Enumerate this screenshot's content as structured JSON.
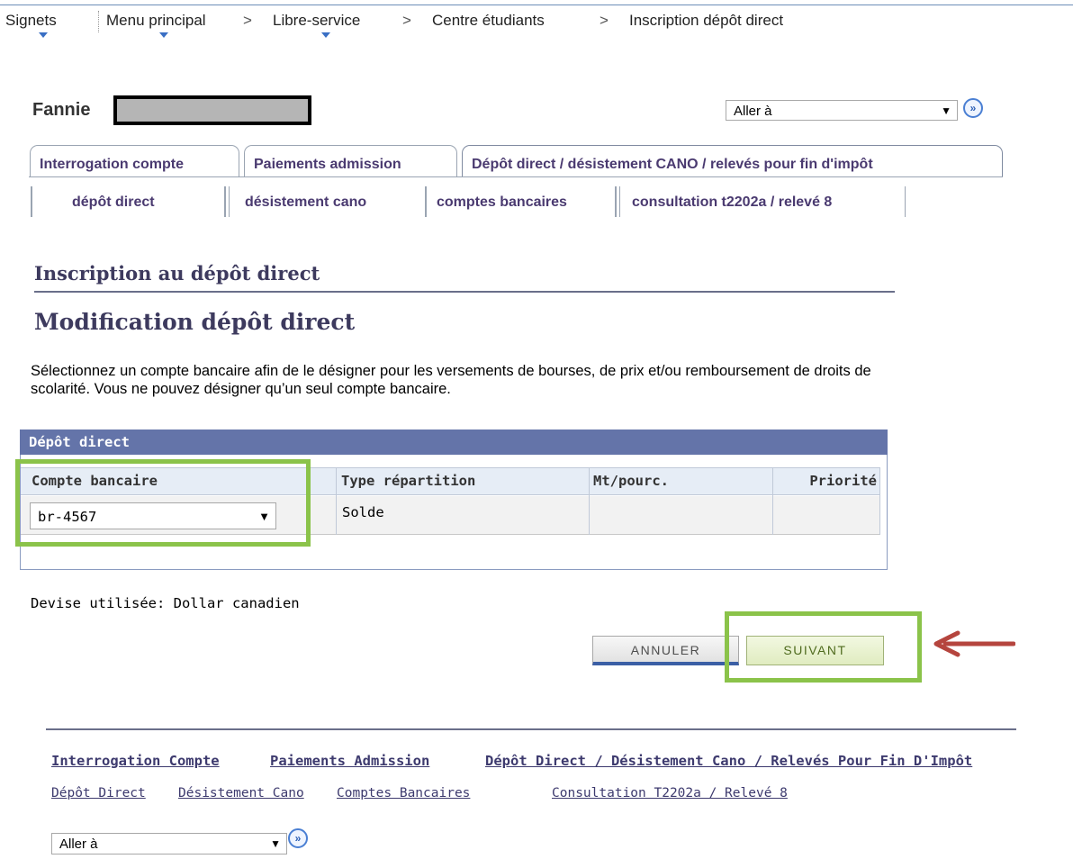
{
  "breadcrumb": {
    "bookmarks": "Signets",
    "main_menu": "Menu principal",
    "self_service": "Libre-service",
    "student_center": "Centre étudiants",
    "current": "Inscription dépôt direct",
    "separator": ">"
  },
  "header": {
    "first_name": "Fannie",
    "goto_value": "Aller à",
    "goto_button": "»"
  },
  "tabs": [
    {
      "label": "Interrogation compte"
    },
    {
      "label": "Paiements admission"
    },
    {
      "label": "Dépôt direct / désistement CANO / relevés pour fin d'impôt"
    }
  ],
  "subtabs": [
    {
      "label": "dépôt direct"
    },
    {
      "label": "désistement cano"
    },
    {
      "label": "comptes bancaires"
    },
    {
      "label": "consultation t2202a / relevé 8"
    }
  ],
  "page": {
    "title": "Inscription au dépôt direct",
    "subtitle": "Modification dépôt direct",
    "instructions": "Sélectionnez un compte bancaire afin de le désigner pour les versements de bourses, de prix et/ou remboursement de droits de scolarité. Vous ne pouvez désigner qu’un seul compte bancaire."
  },
  "grid": {
    "title": "Dépôt direct",
    "columns": [
      "Compte bancaire",
      "Type répartition",
      "Mt/pourc.",
      "Priorité"
    ],
    "rows": [
      {
        "account": "br-4567",
        "type": "Solde",
        "amount": "",
        "priority": ""
      }
    ]
  },
  "currency_text": "Devise utilisée: Dollar canadien",
  "buttons": {
    "cancel": "ANNULER",
    "next": "SUIVANT"
  },
  "footer": {
    "links_main": [
      "Interrogation Compte",
      "Paiements Admission",
      "Dépôt Direct / Désistement Cano / Relevés Pour Fin D'Impôt"
    ],
    "links_sub": [
      "Dépôt Direct",
      "Désistement Cano",
      "Comptes Bancaires",
      "Consultation T2202a / Relevé 8"
    ],
    "goto_value": "Aller à",
    "goto_button": "»"
  },
  "colors": {
    "highlight": "#8bc34a",
    "arrow": "#b5453e",
    "grid_header": "#6474a9",
    "tab_text": "#4a3a70"
  }
}
